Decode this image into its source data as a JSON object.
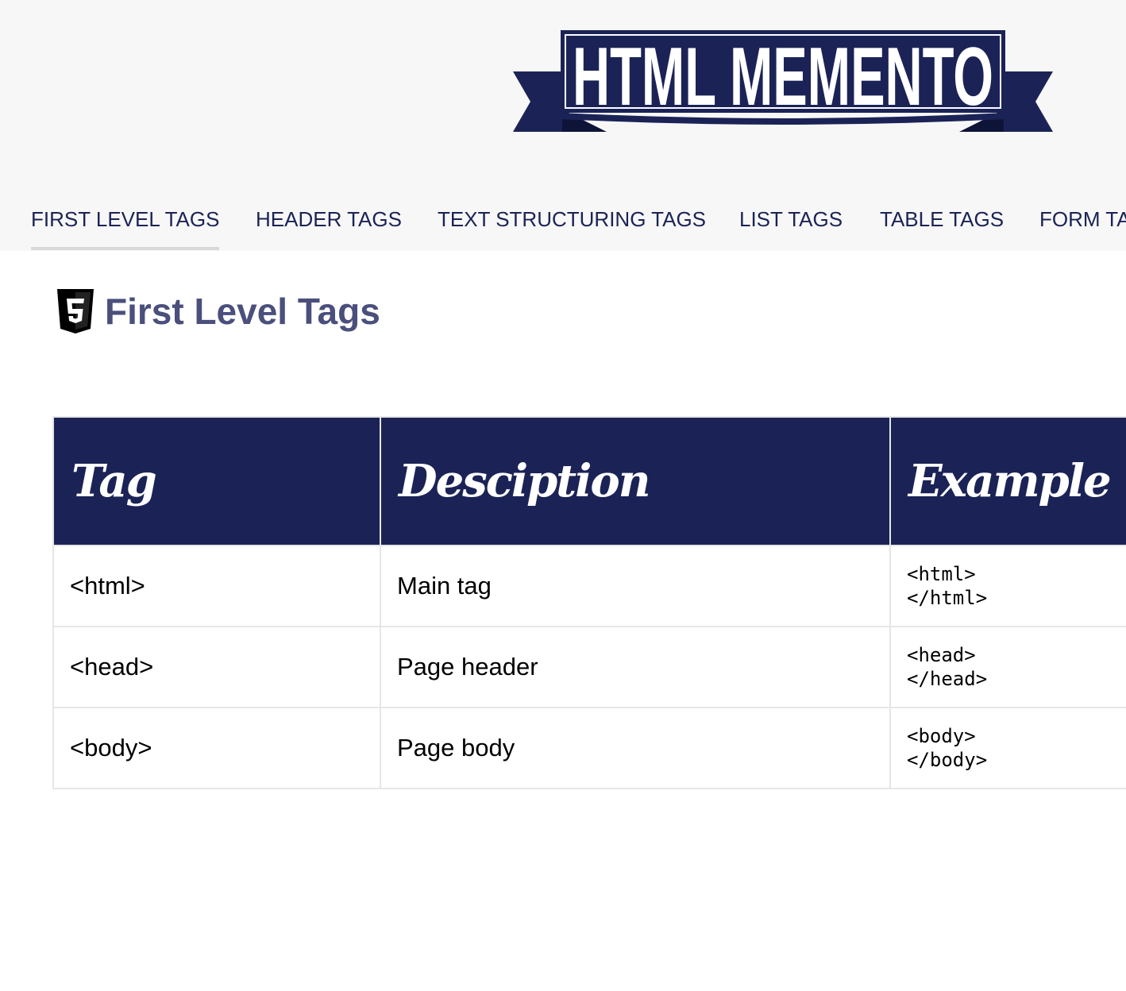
{
  "logo": {
    "text": "HTML MEMENTO",
    "color": "#1b2356"
  },
  "nav": {
    "items": [
      {
        "label": "FIRST LEVEL TAGS",
        "active": true
      },
      {
        "label": "HEADER TAGS"
      },
      {
        "label": "TEXT STRUCTURING TAGS"
      },
      {
        "label": "LIST TAGS"
      },
      {
        "label": "TABLE TAGS"
      },
      {
        "label": "FORM TA"
      }
    ]
  },
  "section": {
    "title": "First Level Tags",
    "icon": "html5-icon"
  },
  "table": {
    "headers": [
      "Tag",
      "Desciption",
      "Example"
    ],
    "rows": [
      {
        "tag": "<html>",
        "description": "Main tag",
        "example": "<html>\n</html>"
      },
      {
        "tag": "<head>",
        "description": "Page header",
        "example": "<head>\n</head>"
      },
      {
        "tag": "<body>",
        "description": "Page body",
        "example": "<body>\n</body>"
      }
    ]
  },
  "colors": {
    "navy": "#1b2356",
    "title": "#4a4f7c",
    "header_bg": "#f7f7f7"
  }
}
